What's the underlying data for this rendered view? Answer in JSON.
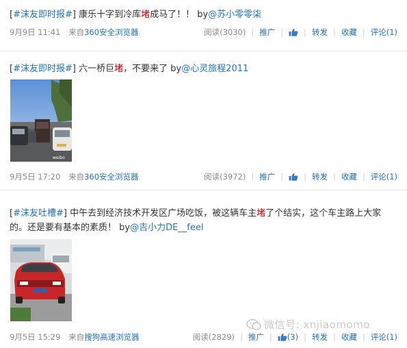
{
  "posts": [
    {
      "topic_open": "[",
      "topic": "#沫友即时报#",
      "topic_close": "]",
      "text_a": " 康乐十字到冷库",
      "highlight": "堵",
      "text_b": "成马了！！ by",
      "mention": "@苏小零零柒",
      "text_c": "",
      "date": "9月9日 11:41",
      "from_label": "来自",
      "source": "360安全浏览器",
      "read": "阅读(3030)",
      "recommend": "推广",
      "like": "",
      "forward": "转发",
      "favorite": "收藏",
      "comment": "评论(1)"
    },
    {
      "topic_open": "[",
      "topic": "#沫友即时报#",
      "topic_close": "]",
      "text_a": " 六一桥巨",
      "highlight": "堵",
      "text_b": "，不要来了 by",
      "mention": "@心灵旅程2011",
      "text_c": "",
      "date": "9月5日 17:20",
      "from_label": "来自",
      "source": "360安全浏览器",
      "read": "阅读(3972)",
      "recommend": "推广",
      "like": "",
      "forward": "转发",
      "favorite": "收藏",
      "comment": "评论(1)"
    },
    {
      "topic_open": "[",
      "topic": "#沫友吐槽#",
      "topic_close": "]",
      "text_a": " 中午去到经济技术开发区广场吃饭，被这辆车主",
      "highlight": "堵",
      "text_b": "了个结实，这个车主路上大家的。还是要有基本的素质！ by",
      "mention": "@吉小力DE__feel",
      "text_c": "",
      "date": "9月5日 15:29",
      "from_label": "来自",
      "source": "搜狗高速浏览器",
      "read": "阅读(2829)",
      "recommend": "推广",
      "like": "(3)",
      "forward": "转发",
      "favorite": "收藏",
      "comment": "评论(1)"
    }
  ],
  "watermark": "微信号: xnjiaomomo",
  "colors": {
    "link": "#1f72b7",
    "highlight": "#c00000",
    "meta": "#888888"
  }
}
